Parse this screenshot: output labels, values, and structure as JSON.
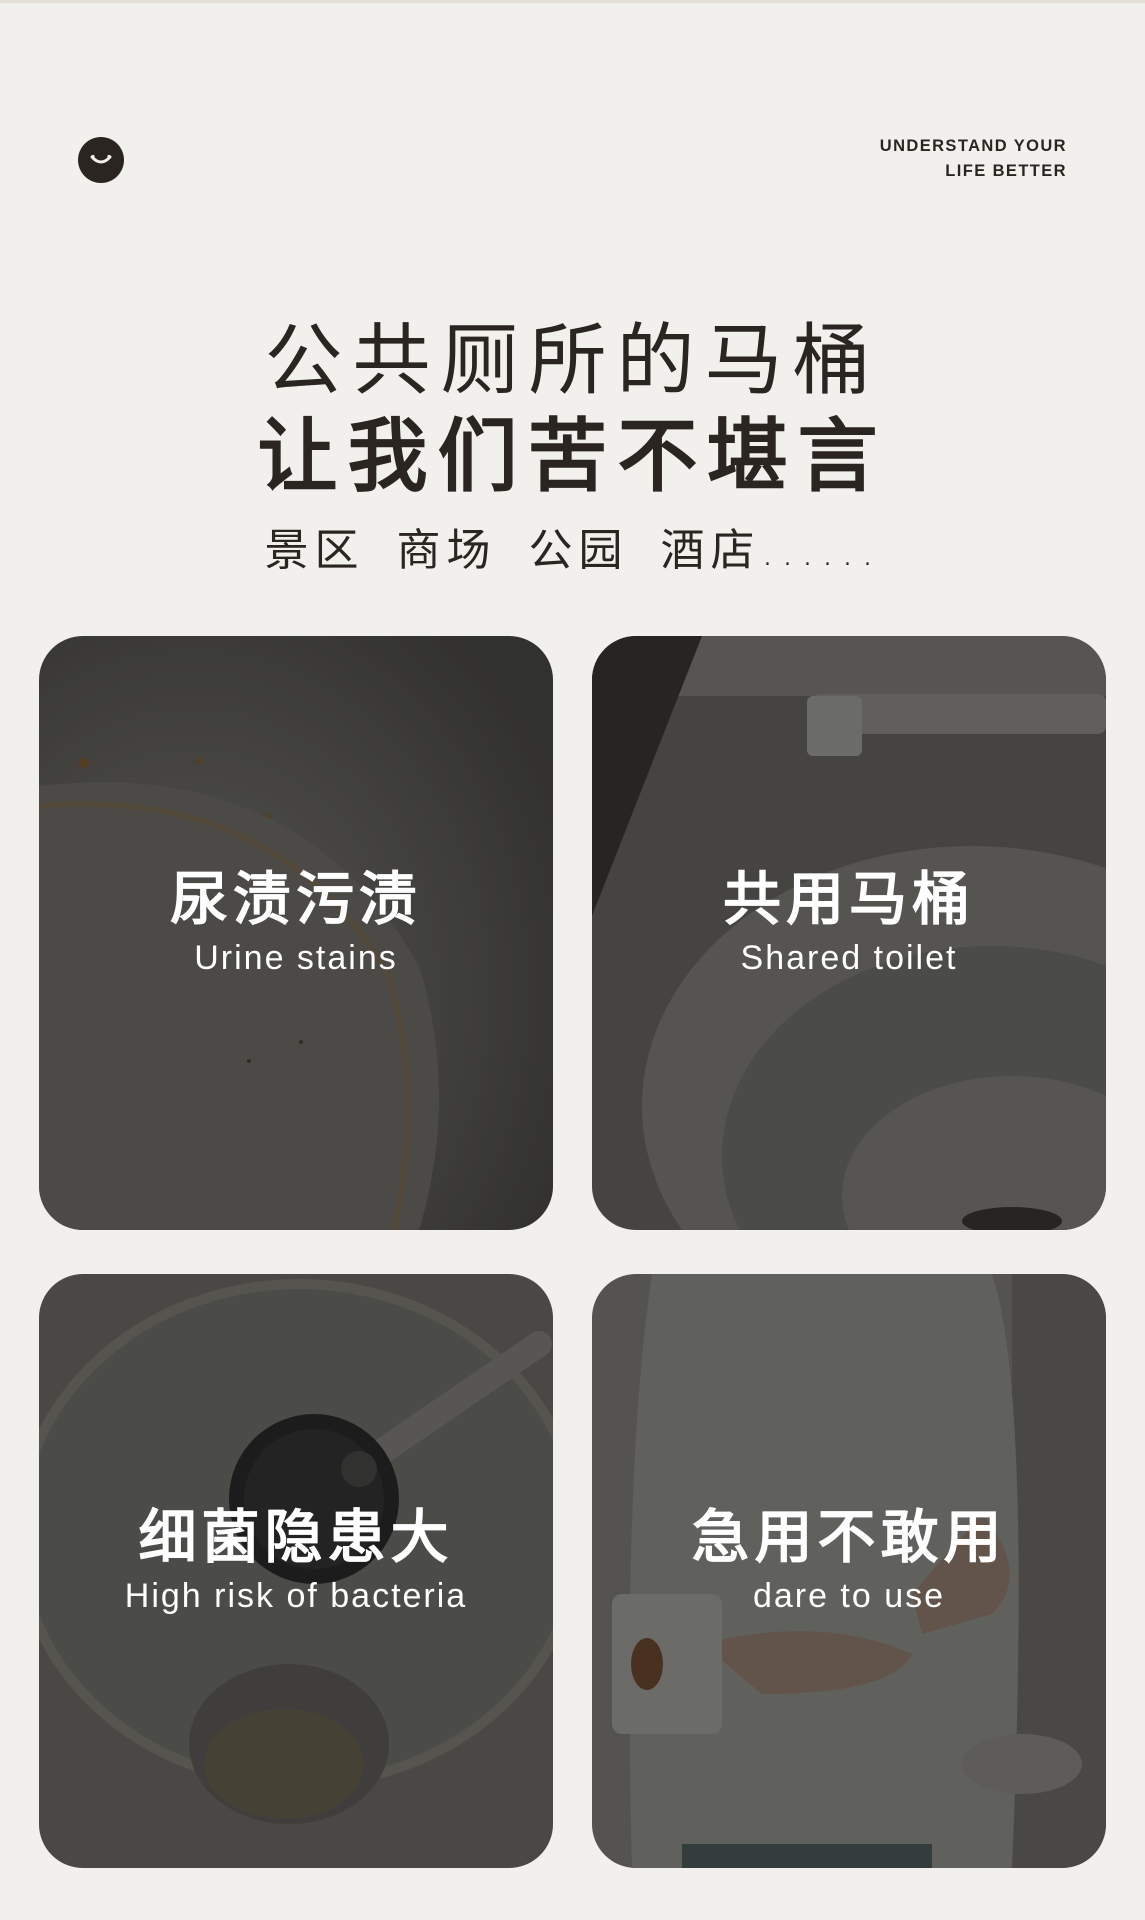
{
  "header": {
    "tagline_line1": "UNDERSTAND YOUR",
    "tagline_line2": "LIFE BETTER",
    "logo_icon": "smile-logo-icon"
  },
  "heading": {
    "line1": "公共厕所的马桶",
    "line2": "让我们苦不堪言",
    "places": [
      "景区",
      "商场",
      "公园",
      "酒店......"
    ]
  },
  "cards": [
    {
      "title": "尿渍污渍",
      "subtitle": "Urine stains"
    },
    {
      "title": "共用马桶",
      "subtitle": "Shared toilet"
    },
    {
      "title": "细菌隐患大",
      "subtitle": "High risk of bacteria"
    },
    {
      "title": "急用不敢用",
      "subtitle": "dare to use"
    }
  ],
  "colors": {
    "background": "#f2f0ed",
    "text_dark": "#2b2522",
    "card_text": "#ffffff"
  }
}
